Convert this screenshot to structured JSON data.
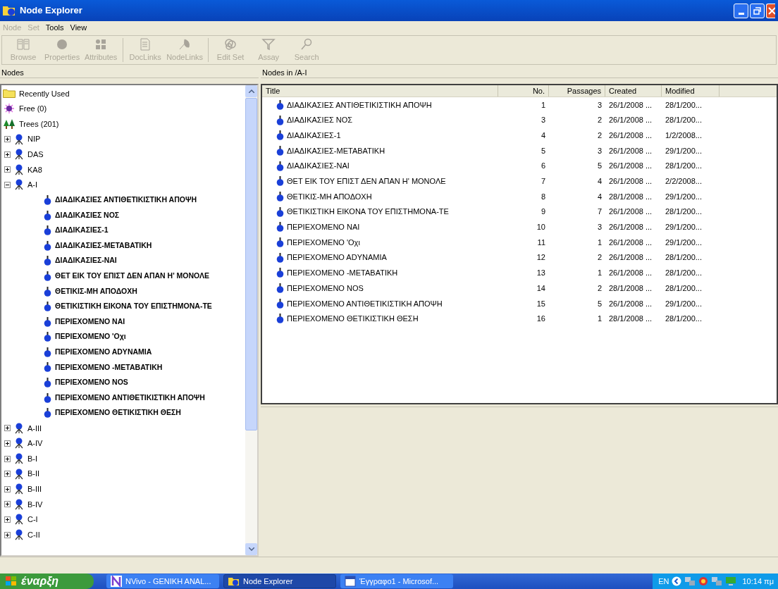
{
  "window": {
    "title": "Node Explorer"
  },
  "menu": [
    {
      "label": "Node",
      "disabled": true
    },
    {
      "label": "Set",
      "disabled": true
    },
    {
      "label": "Tools",
      "disabled": false
    },
    {
      "label": "View",
      "disabled": false
    }
  ],
  "toolbar": [
    [
      {
        "label": "Browse",
        "kind": "book",
        "disabled": true
      },
      {
        "label": "Properties",
        "kind": "circle",
        "disabled": true
      },
      {
        "label": "Attributes",
        "kind": "grid",
        "disabled": true
      }
    ],
    [
      {
        "label": "DocLinks",
        "kind": "doc",
        "disabled": true
      },
      {
        "label": "NodeLinks",
        "kind": "leafy",
        "disabled": true
      }
    ],
    [
      {
        "label": "Edit Set",
        "kind": "rings",
        "disabled": true
      },
      {
        "label": "Assay",
        "kind": "funnel",
        "disabled": true
      },
      {
        "label": "Search",
        "kind": "magnifier",
        "disabled": true
      }
    ]
  ],
  "left_pane": {
    "header": "Nodes",
    "tree": [
      {
        "label": "Recently Used",
        "kind": "folder"
      },
      {
        "label": "Free (0)",
        "kind": "free"
      },
      {
        "label": "Trees (201)",
        "kind": "trees",
        "children": [
          {
            "label": "NIP",
            "kind": "node",
            "expanded": false
          },
          {
            "label": "DAS",
            "kind": "node",
            "expanded": false
          },
          {
            "label": "KA8",
            "kind": "node",
            "expanded": false
          },
          {
            "label": "A-I",
            "kind": "node",
            "expanded": true,
            "children": [
              {
                "label": "ΔΙΑΔΙΚΑΣΙΕΣ  ΑΝΤΙΘΕΤΙΚΙΣΤΙΚΗ ΑΠΟΨΗ",
                "kind": "leaf"
              },
              {
                "label": "ΔΙΑΔΙΚΑΣΙΕΣ  ΝΟΣ",
                "kind": "leaf"
              },
              {
                "label": "ΔΙΑΔΙΚΑΣΙΕΣ-1",
                "kind": "leaf"
              },
              {
                "label": "ΔΙΑΔΙΚΑΣΙΕΣ-ΜΕΤΑΒΑΤΙΚΗ",
                "kind": "leaf"
              },
              {
                "label": "ΔΙΑΔΙΚΑΣΙΕΣ-ΝΑΙ",
                "kind": "leaf"
              },
              {
                "label": "ΘΕΤ ΕΙΚ ΤΟΥ ΕΠΙΣΤ ΔΕΝ ΑΠΑΝ Η' ΜΟΝΟΛΕ",
                "kind": "leaf"
              },
              {
                "label": "ΘΕΤΙΚΙΣ-ΜΗ ΑΠΟΔΟΧΗ",
                "kind": "leaf"
              },
              {
                "label": "ΘΕΤΙΚΙΣΤΙΚΗ ΕΙΚΟΝΑ ΤΟΥ ΕΠΙΣΤΗΜΟΝΑ-ΤΕ",
                "kind": "leaf"
              },
              {
                "label": "ΠΕΡΙΕΧΟΜΕΝΟ  ΝΑΙ",
                "kind": "leaf"
              },
              {
                "label": "ΠΕΡΙΕΧΟΜΕΝΟ  'Οχι",
                "kind": "leaf"
              },
              {
                "label": "ΠΕΡΙΕΧΟΜΕΝΟ ΑDYΝΑΜΙΑ",
                "kind": "leaf"
              },
              {
                "label": "ΠΕΡΙΕΧΟΜΕΝΟ -ΜΕΤΑΒΑΤΙΚΗ",
                "kind": "leaf"
              },
              {
                "label": "ΠΕΡΙΕΧΟΜΕΝΟ NOS",
                "kind": "leaf"
              },
              {
                "label": "ΠΕΡΙΕΧΟΜΕΝΟ ΑΝΤΙΘΕΤΙΚΙΣΤΙΚΗ ΑΠΟΨΗ",
                "kind": "leaf"
              },
              {
                "label": "ΠΕΡΙΕΧΟΜΕΝΟ ΘΕΤΙΚΙΣΤΙΚΗ ΘΕΣΗ",
                "kind": "leaf"
              }
            ]
          },
          {
            "label": "A-III",
            "kind": "node",
            "expanded": false
          },
          {
            "label": "A-IV",
            "kind": "node",
            "expanded": false
          },
          {
            "label": "B-I",
            "kind": "node",
            "expanded": false
          },
          {
            "label": "B-II",
            "kind": "node",
            "expanded": false
          },
          {
            "label": "B-III",
            "kind": "node",
            "expanded": false
          },
          {
            "label": "B-IV",
            "kind": "node",
            "expanded": false
          },
          {
            "label": "C-I",
            "kind": "node",
            "expanded": false
          },
          {
            "label": "C-II",
            "kind": "node",
            "expanded": false
          }
        ]
      }
    ]
  },
  "right_pane": {
    "header": "Nodes in /A-I",
    "table": {
      "columns": [
        "Title",
        "No.",
        "Passages",
        "Created",
        "Modified"
      ],
      "rows": [
        [
          "ΔΙΑΔΙΚΑΣΙΕΣ  ΑΝΤΙΘΕΤΙΚΙΣΤΙΚΗ ΑΠΟΨΗ",
          "1",
          "3",
          "26/1/2008 ...",
          "28/1/200..."
        ],
        [
          "ΔΙΑΔΙΚΑΣΙΕΣ  ΝΟΣ",
          "3",
          "2",
          "26/1/2008 ...",
          "28/1/200..."
        ],
        [
          "ΔΙΑΔΙΚΑΣΙΕΣ-1",
          "4",
          "2",
          "26/1/2008 ...",
          "1/2/2008..."
        ],
        [
          "ΔΙΑΔΙΚΑΣΙΕΣ-ΜΕΤΑΒΑΤΙΚΗ",
          "5",
          "3",
          "26/1/2008 ...",
          "29/1/200..."
        ],
        [
          "ΔΙΑΔΙΚΑΣΙΕΣ-ΝΑΙ",
          "6",
          "5",
          "26/1/2008 ...",
          "28/1/200..."
        ],
        [
          "ΘΕΤ ΕΙΚ ΤΟΥ ΕΠΙΣΤ ΔΕΝ ΑΠΑΝ Η' ΜΟΝΟΛΕ",
          "7",
          "4",
          "26/1/2008 ...",
          "2/2/2008..."
        ],
        [
          "ΘΕΤΙΚΙΣ-ΜΗ ΑΠΟΔΟΧΗ",
          "8",
          "4",
          "28/1/2008 ...",
          "29/1/200..."
        ],
        [
          "ΘΕΤΙΚΙΣΤΙΚΗ ΕΙΚΟΝΑ ΤΟΥ ΕΠΙΣΤΗΜΟΝΑ-ΤΕ",
          "9",
          "7",
          "26/1/2008 ...",
          "28/1/200..."
        ],
        [
          "ΠΕΡΙΕΧΟΜΕΝΟ  ΝΑΙ",
          "10",
          "3",
          "26/1/2008 ...",
          "29/1/200..."
        ],
        [
          "ΠΕΡΙΕΧΟΜΕΝΟ  'Οχι",
          "11",
          "1",
          "26/1/2008 ...",
          "29/1/200..."
        ],
        [
          "ΠΕΡΙΕΧΟΜΕΝΟ ΑDYΝΑΜΙΑ",
          "12",
          "2",
          "26/1/2008 ...",
          "28/1/200..."
        ],
        [
          "ΠΕΡΙΕΧΟΜΕΝΟ -ΜΕΤΑΒΑΤΙΚΗ",
          "13",
          "1",
          "26/1/2008 ...",
          "28/1/200..."
        ],
        [
          "ΠΕΡΙΕΧΟΜΕΝΟ NOS",
          "14",
          "2",
          "28/1/2008 ...",
          "28/1/200..."
        ],
        [
          "ΠΕΡΙΕΧΟΜΕΝΟ ΑΝΤΙΘΕΤΙΚΙΣΤΙΚΗ ΑΠΟΨΗ",
          "15",
          "5",
          "26/1/2008 ...",
          "29/1/200..."
        ],
        [
          "ΠΕΡΙΕΧΟΜΕΝΟ ΘΕΤΙΚΙΣΤΙΚΗ ΘΕΣΗ",
          "16",
          "1",
          "28/1/2008 ...",
          "28/1/200..."
        ]
      ]
    }
  },
  "taskbar": {
    "start": "έναρξη",
    "tasks": [
      {
        "label": "NVivo - GENIKH ANAL...",
        "kind": "nvivo",
        "selected": false
      },
      {
        "label": "Node Explorer",
        "kind": "explorer",
        "selected": true
      },
      {
        "label": "Έγγραφο1 - Microsof...",
        "kind": "word",
        "selected": false
      }
    ],
    "language": "EN",
    "clock": "10:14 πμ"
  }
}
